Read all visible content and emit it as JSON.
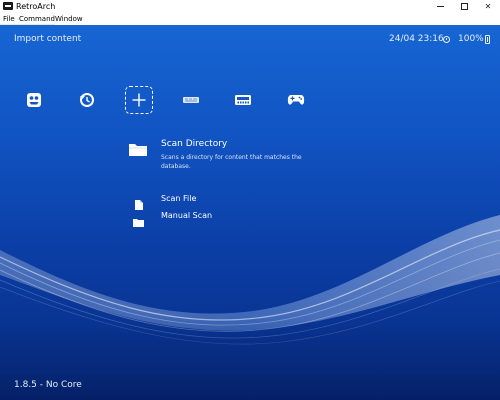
{
  "window": {
    "title": "RetroArch",
    "controls": {
      "minimize": "minimize-icon",
      "maximize": "maximize-icon",
      "close": "close-icon",
      "close_glyph": "✕"
    }
  },
  "menubar": {
    "items": [
      "File",
      "Command",
      "Window"
    ]
  },
  "header": {
    "title": "Import content",
    "datetime": "24/04 23:16",
    "battery": "100%"
  },
  "tabs": [
    {
      "name": "main-menu",
      "icon": "retroarch-icon",
      "selected": false
    },
    {
      "name": "history",
      "icon": "history-icon",
      "selected": false
    },
    {
      "name": "import-content",
      "icon": "plus-icon",
      "selected": true
    },
    {
      "name": "playlist-1",
      "icon": "console-cartridge-icon",
      "selected": false
    },
    {
      "name": "playlist-2",
      "icon": "console-icon",
      "selected": false
    },
    {
      "name": "netplay",
      "icon": "gamepad-icon",
      "selected": false
    }
  ],
  "entries": {
    "scan_directory": {
      "label": "Scan Directory",
      "sublabel": "Scans a directory for content that matches the database.",
      "icon": "folder-icon"
    },
    "scan_file": {
      "label": "Scan File",
      "icon": "file-icon"
    },
    "manual_scan": {
      "label": "Manual Scan",
      "icon": "folder-icon"
    }
  },
  "footer": {
    "version": "1.8.5 - No Core"
  },
  "colors": {
    "background_top": "#1666d3",
    "background_bottom": "#072a80",
    "text": "#ffffff"
  }
}
